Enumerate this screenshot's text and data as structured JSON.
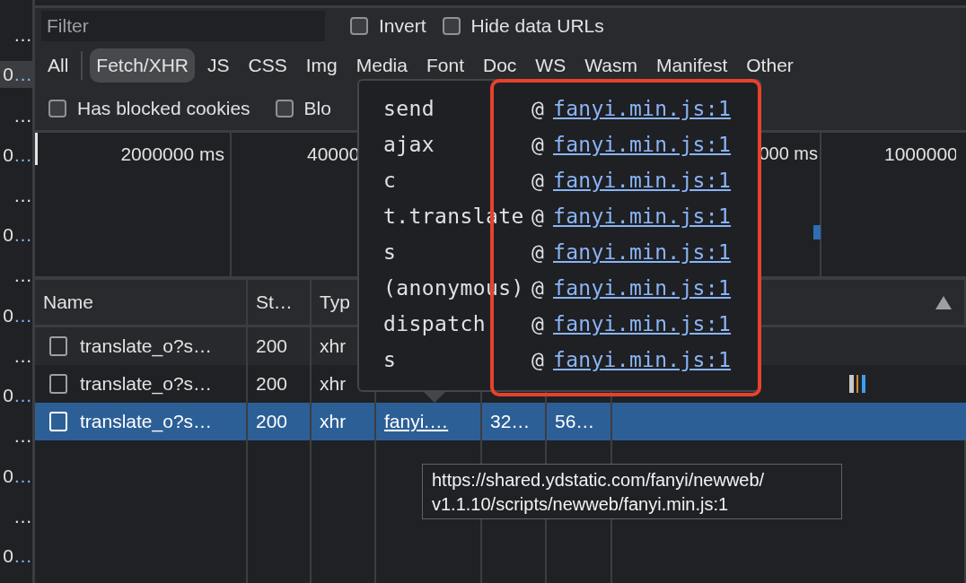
{
  "left_panel": {
    "rows": [
      {
        "ellipsis": "…",
        "selected": false
      },
      {
        "value": "0",
        "ellipsis": "…",
        "selected": true
      },
      {
        "ellipsis": "…",
        "selected": false
      },
      {
        "value": "0",
        "ellipsis": "…",
        "selected": false
      },
      {
        "ellipsis": "…",
        "selected": false
      },
      {
        "value": "0",
        "ellipsis": "…",
        "selected": false
      },
      {
        "ellipsis": "…",
        "selected": false
      },
      {
        "value": "0",
        "ellipsis": "…",
        "selected": false
      },
      {
        "ellipsis": "…",
        "selected": false
      },
      {
        "value": "0",
        "ellipsis": "…",
        "selected": false
      },
      {
        "ellipsis": "…",
        "selected": false
      },
      {
        "value": "0",
        "ellipsis": "…",
        "selected": false
      },
      {
        "ellipsis": "…",
        "selected": false
      },
      {
        "value": "0",
        "ellipsis": "…",
        "selected": false
      }
    ]
  },
  "toolbar": {
    "filter": {
      "placeholder": "Filter"
    },
    "options": [
      {
        "label": "Invert",
        "checked": false
      },
      {
        "label": "Hide data URLs",
        "checked": false
      }
    ],
    "type_filters": [
      {
        "label": "All",
        "selected": false
      },
      {
        "label": "Fetch/XHR",
        "selected": true
      },
      {
        "label": "JS",
        "selected": false
      },
      {
        "label": "CSS",
        "selected": false
      },
      {
        "label": "Img",
        "selected": false
      },
      {
        "label": "Media",
        "selected": false
      },
      {
        "label": "Font",
        "selected": false
      },
      {
        "label": "Doc",
        "selected": false
      },
      {
        "label": "WS",
        "selected": false
      },
      {
        "label": "Wasm",
        "selected": false
      },
      {
        "label": "Manifest",
        "selected": false
      },
      {
        "label": "Other",
        "selected": false
      }
    ],
    "more_options": [
      {
        "label": "Has blocked cookies",
        "checked": false
      },
      {
        "label": "Blo",
        "checked": false
      }
    ]
  },
  "overview": {
    "ticks": [
      "2000000 ms",
      "40000",
      "000 ms",
      "1000000"
    ]
  },
  "table": {
    "columns": [
      "Name",
      "St…",
      "Typ"
    ],
    "rows": [
      {
        "name": "translate_o?s…",
        "status": "200",
        "type": "xhr",
        "checked": false,
        "selected": false
      },
      {
        "name": "translate_o?s…",
        "status": "200",
        "type": "xhr",
        "checked": false,
        "selected": false
      },
      {
        "name": "translate_o?s…",
        "status": "200",
        "type": "xhr",
        "initiator": "fanyi.…",
        "size": "32…",
        "time": "56…",
        "checked": false,
        "selected": true
      }
    ]
  },
  "call_stack_popover": {
    "frames": [
      {
        "function": "send",
        "at": "@",
        "link": "fanyi.min.js:1"
      },
      {
        "function": "ajax",
        "at": "@",
        "link": "fanyi.min.js:1"
      },
      {
        "function": "c",
        "at": "@",
        "link": "fanyi.min.js:1"
      },
      {
        "function": "t.translate",
        "at": "@",
        "link": "fanyi.min.js:1"
      },
      {
        "function": "s",
        "at": "@",
        "link": "fanyi.min.js:1"
      },
      {
        "function": "(anonymous)",
        "at": "@",
        "link": "fanyi.min.js:1"
      },
      {
        "function": "dispatch",
        "at": "@",
        "link": "fanyi.min.js:1"
      },
      {
        "function": "s",
        "at": "@",
        "link": "fanyi.min.js:1"
      }
    ]
  },
  "tooltip": {
    "lines": [
      "https://shared.ydstatic.com/fanyi/newweb/",
      "v1.1.10/scripts/newweb/fanyi.min.js:1"
    ]
  }
}
